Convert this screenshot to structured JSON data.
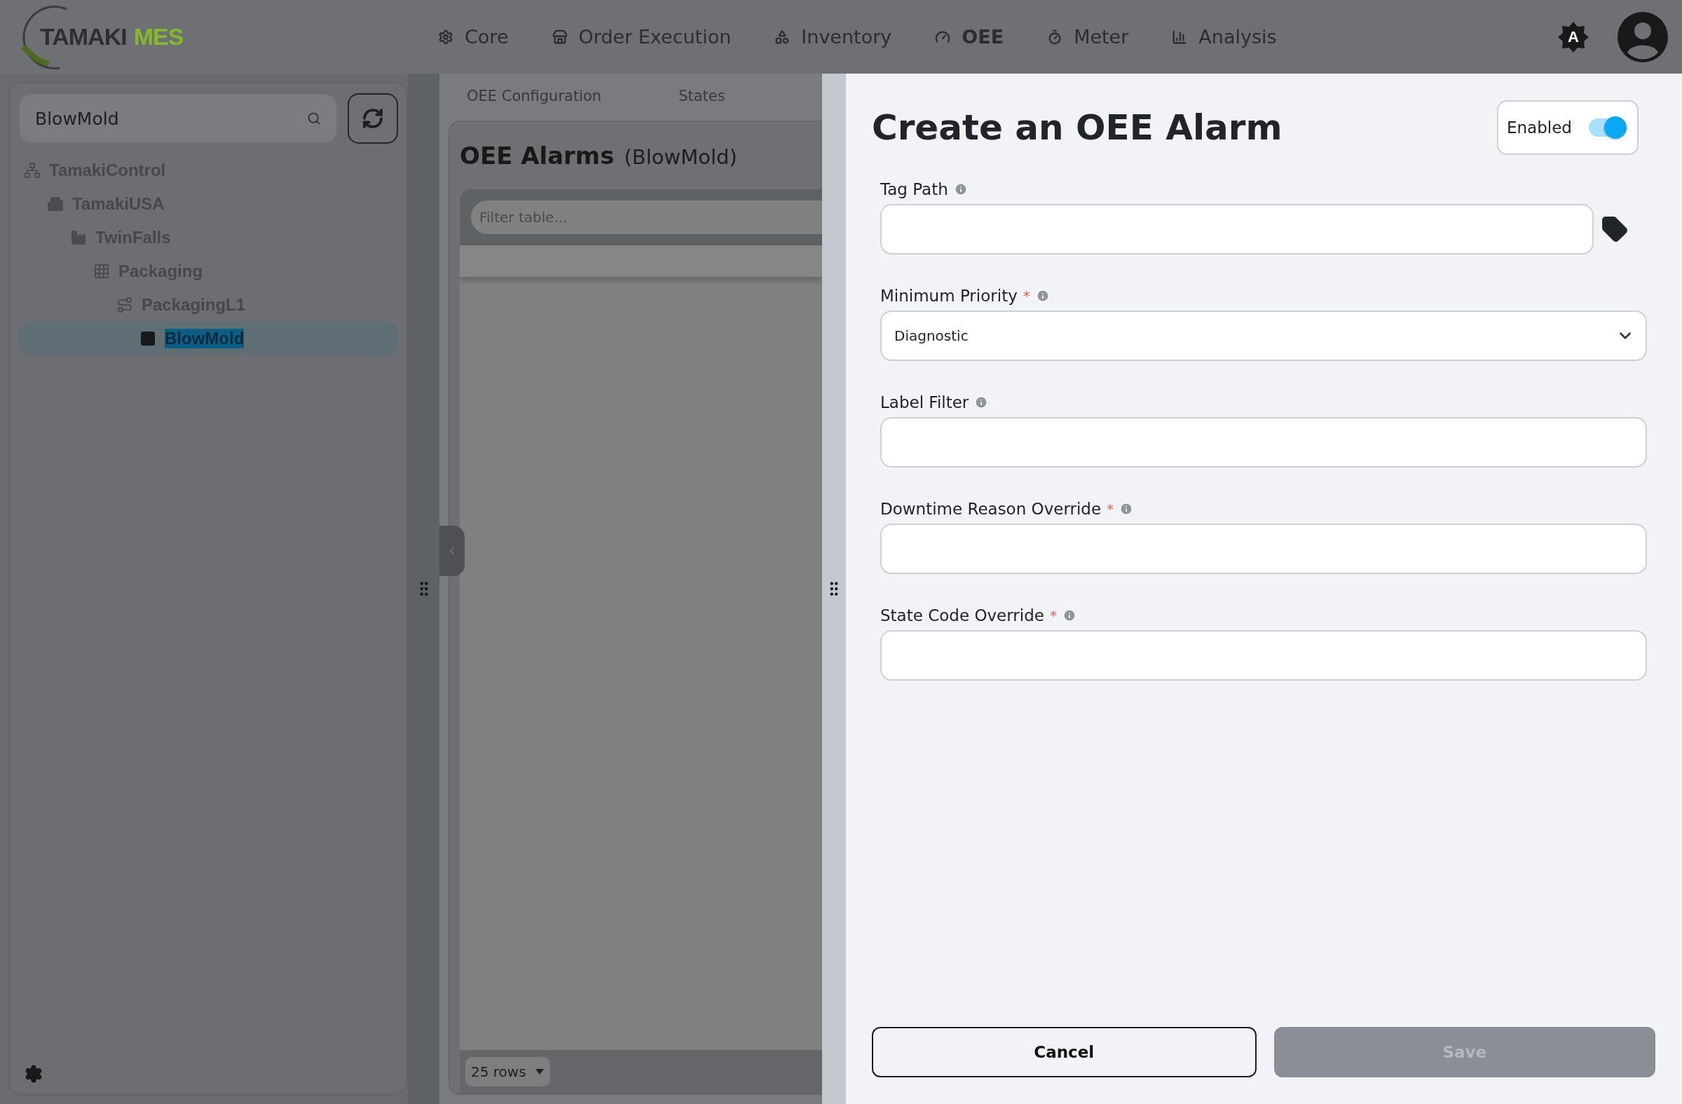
{
  "logo": {
    "primary": "TAMAKI",
    "secondary": "MES"
  },
  "nav": [
    {
      "label": "Core",
      "selected": false
    },
    {
      "label": "Order Execution",
      "selected": false
    },
    {
      "label": "Inventory",
      "selected": false
    },
    {
      "label": "OEE",
      "selected": true
    },
    {
      "label": "Meter",
      "selected": false
    },
    {
      "label": "Analysis",
      "selected": false
    }
  ],
  "theme_badge": "A",
  "sidebar": {
    "search": {
      "value": "BlowMold"
    },
    "tree": [
      {
        "label": "TamakiControl",
        "selected": false,
        "children": [
          {
            "label": "TamakiUSA",
            "selected": false,
            "children": [
              {
                "label": "TwinFalls",
                "selected": false,
                "children": [
                  {
                    "label": "Packaging",
                    "selected": false,
                    "children": [
                      {
                        "label": "PackagingL1",
                        "selected": false,
                        "children": [
                          {
                            "label": "BlowMold",
                            "selected": true
                          }
                        ]
                      }
                    ]
                  }
                ]
              }
            ]
          }
        ]
      }
    ]
  },
  "main": {
    "tabs": [
      {
        "label": "OEE Configuration",
        "selected": false
      },
      {
        "label": "States",
        "selected": false
      }
    ],
    "title": "OEE Alarms",
    "subtitle": "(BlowMold)",
    "filter": {
      "placeholder": "Filter table..."
    },
    "page_size": "25 rows"
  },
  "drawer": {
    "title": "Create an OEE Alarm",
    "enabled": {
      "label": "Enabled",
      "on": true
    },
    "fields": [
      {
        "label": "Tag Path",
        "kind": "tag"
      },
      {
        "label": "Minimum Priority",
        "required_mark": "*",
        "kind": "select",
        "value": "Diagnostic"
      },
      {
        "label": "Label Filter",
        "kind": "text"
      },
      {
        "label": "Downtime Reason Override",
        "required_mark": "*",
        "kind": "text"
      },
      {
        "label": "State Code Override",
        "required_mark": "*",
        "kind": "text"
      }
    ],
    "buttons": [
      {
        "label": "Cancel",
        "disabled": false
      },
      {
        "label": "Save",
        "disabled": true
      }
    ]
  }
}
